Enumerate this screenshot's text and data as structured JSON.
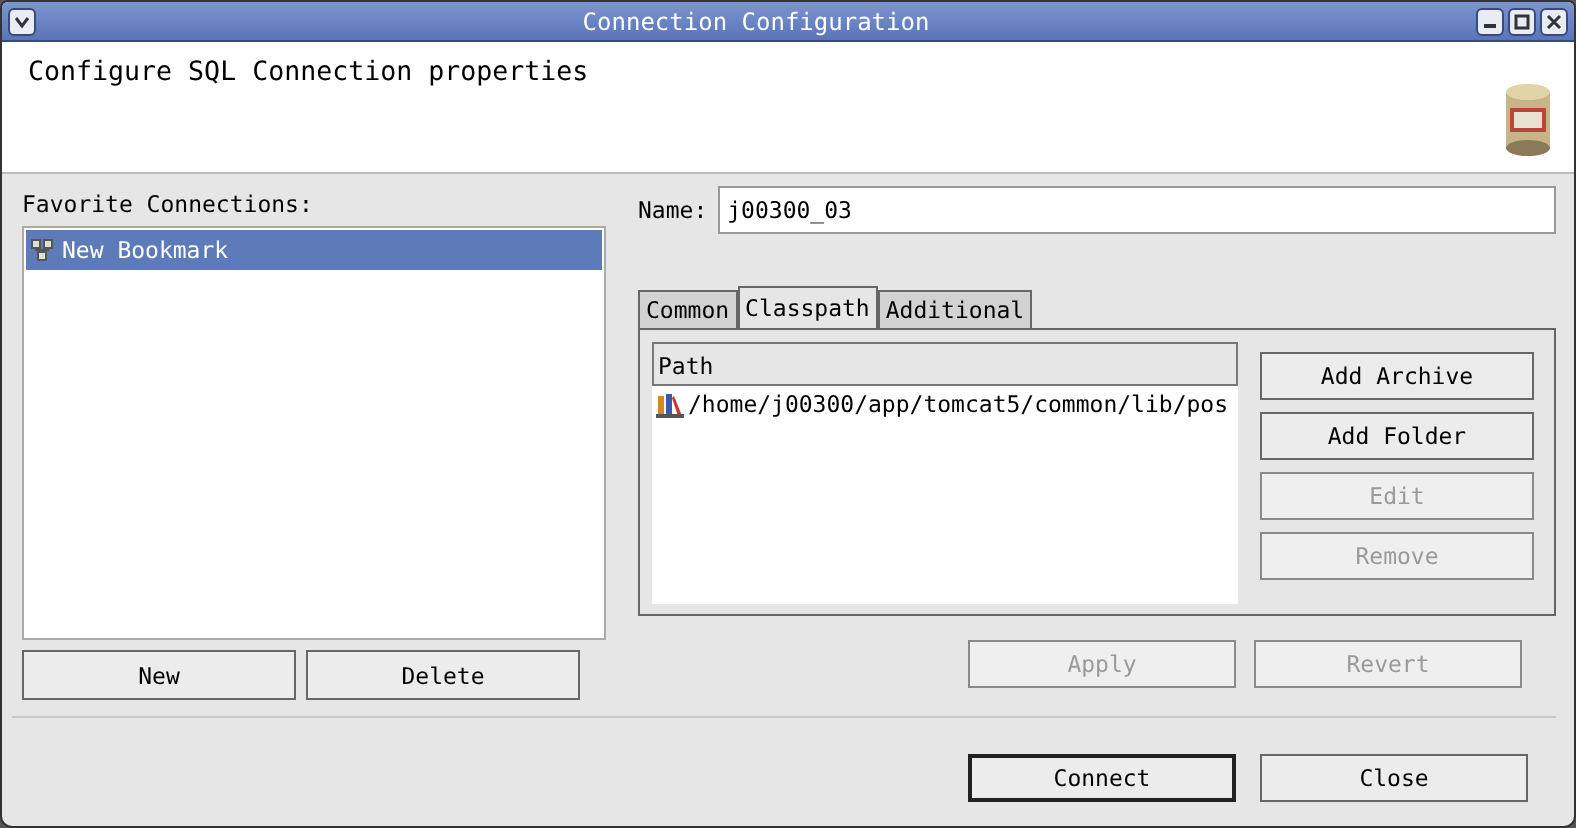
{
  "window": {
    "title": "Connection Configuration"
  },
  "header": {
    "text": "Configure SQL Connection properties"
  },
  "favorites": {
    "label": "Favorite Connections:",
    "items": [
      {
        "label": "New Bookmark",
        "selected": true
      }
    ],
    "buttons": [
      {
        "label": "New",
        "disabled": false
      },
      {
        "label": "Delete",
        "disabled": false
      }
    ]
  },
  "name_field": {
    "label": "Name:",
    "value": "j00300_03"
  },
  "tabs": [
    {
      "label": "Common",
      "selected": false
    },
    {
      "label": "Classpath",
      "selected": true
    },
    {
      "label": "Additional",
      "selected": false
    }
  ],
  "classpath": {
    "column": "Path",
    "rows": [
      "/home/j00300/app/tomcat5/common/lib/pos"
    ],
    "buttons": [
      {
        "label": "Add Archive",
        "disabled": false
      },
      {
        "label": "Add Folder",
        "disabled": false
      },
      {
        "label": "Edit",
        "disabled": true
      },
      {
        "label": "Remove",
        "disabled": true
      }
    ]
  },
  "form_buttons": [
    {
      "label": "Apply",
      "disabled": true
    },
    {
      "label": "Revert",
      "disabled": true
    }
  ],
  "dialog_buttons": [
    {
      "label": "Connect",
      "disabled": false,
      "default": true
    },
    {
      "label": "Close",
      "disabled": false,
      "default": false
    }
  ]
}
